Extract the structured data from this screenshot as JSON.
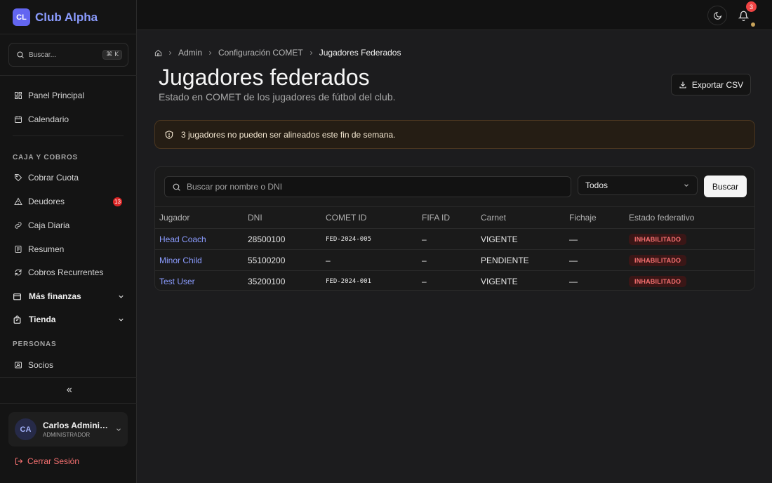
{
  "brand": {
    "logo": "CL",
    "name": "Club Alpha"
  },
  "sidebar": {
    "search_placeholder": "Buscar...",
    "search_shortcut": "⌘ K",
    "top_items": [
      {
        "label": "Panel Principal",
        "icon": "grid-icon"
      },
      {
        "label": "Calendario",
        "icon": "calendar-icon"
      }
    ],
    "section_caja": "CAJA Y COBROS",
    "caja_items": [
      {
        "label": "Cobrar Cuota",
        "icon": "tag-icon"
      },
      {
        "label": "Deudores",
        "icon": "warning-icon",
        "badge": "13"
      },
      {
        "label": "Caja Diaria",
        "icon": "link-icon"
      },
      {
        "label": "Resumen",
        "icon": "document-icon"
      },
      {
        "label": "Cobros Recurrentes",
        "icon": "refresh-icon"
      }
    ],
    "groups": [
      {
        "label": "Más finanzas",
        "icon": "wallet-icon"
      },
      {
        "label": "Tienda",
        "icon": "bag-icon"
      }
    ],
    "section_personas": "PERSONAS",
    "personas_items": [
      {
        "label": "Socios",
        "icon": "id-card-icon"
      }
    ],
    "user": {
      "initials": "CA",
      "name": "Carlos Adminis...",
      "role": "ADMINISTRADOR"
    },
    "logout_label": "Cerrar Sesión"
  },
  "topbar": {
    "notification_count": "3"
  },
  "breadcrumb": {
    "items": [
      "Admin",
      "Configuración COMET"
    ],
    "current": "Jugadores Federados"
  },
  "page": {
    "title": "Jugadores federados",
    "subtitle": "Estado en COMET de los jugadores de fútbol del club.",
    "export_label": "Exportar CSV"
  },
  "alert": {
    "text": "3 jugadores no pueden ser alineados este fin de semana."
  },
  "filters": {
    "search_placeholder": "Buscar por nombre o DNI",
    "select_value": "Todos",
    "search_button": "Buscar"
  },
  "table": {
    "headers": [
      "Jugador",
      "DNI",
      "COMET ID",
      "FIFA ID",
      "Carnet",
      "Fichaje",
      "Estado federativo"
    ],
    "rows": [
      {
        "jugador": "Head Coach",
        "dni": "28500100",
        "comet_id": "FED-2024-005",
        "fifa_id": "–",
        "carnet": "VIGENTE",
        "fichaje": "—",
        "estado": "INHABILITADO"
      },
      {
        "jugador": "Minor Child",
        "dni": "55100200",
        "comet_id": "–",
        "fifa_id": "–",
        "carnet": "PENDIENTE",
        "fichaje": "—",
        "estado": "INHABILITADO"
      },
      {
        "jugador": "Test User",
        "dni": "35200100",
        "comet_id": "FED-2024-001",
        "fifa_id": "–",
        "carnet": "VIGENTE",
        "fichaje": "—",
        "estado": "INHABILITADO"
      }
    ]
  },
  "colors": {
    "accent": "#8b9cff",
    "brand": "#6366f1",
    "danger": "#f87171",
    "warning_bg": "#251d14"
  }
}
